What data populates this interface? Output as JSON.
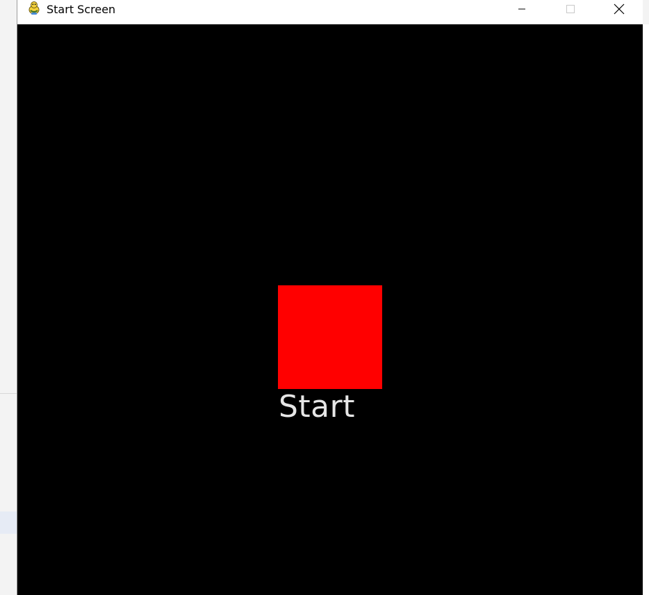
{
  "window": {
    "title": "Start Screen",
    "app_icon": "pygame-snake-icon",
    "controls": {
      "minimize_icon": "minimize-icon",
      "maximize_icon": "maximize-icon",
      "close_icon": "close-icon"
    }
  },
  "game": {
    "background_color": "#000000",
    "start_button": {
      "color": "#ff0000",
      "label": "Start",
      "label_color": "#e6e6e6"
    }
  }
}
